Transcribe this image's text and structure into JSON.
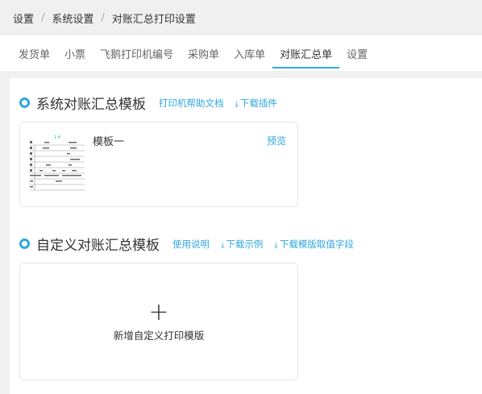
{
  "breadcrumb": {
    "items": [
      "设置",
      "系统设置",
      "对账汇总打印设置"
    ],
    "separator": "/"
  },
  "tabs": [
    {
      "label": "发货单",
      "active": false
    },
    {
      "label": "小票",
      "active": false
    },
    {
      "label": "飞鹅打印机编号",
      "active": false
    },
    {
      "label": "采购单",
      "active": false
    },
    {
      "label": "入库单",
      "active": false
    },
    {
      "label": "对账汇总单",
      "active": true
    },
    {
      "label": "设置",
      "active": false
    }
  ],
  "system_section": {
    "title": "系统对账汇总模板",
    "help_link": "打印机帮助文档",
    "download_plugin": "下载插件",
    "template": {
      "name": "模板一",
      "preview": "预览",
      "thumb_header": "1 4"
    }
  },
  "custom_section": {
    "title": "自定义对账汇总模板",
    "usage_link": "使用说明",
    "download_example": "下载示例",
    "download_fields": "下载模版取值字段",
    "add_label": "新增自定义打印模版",
    "add_icon": "+"
  },
  "colors": {
    "accent": "#2ea7e0",
    "background": "#f0f0f0"
  }
}
